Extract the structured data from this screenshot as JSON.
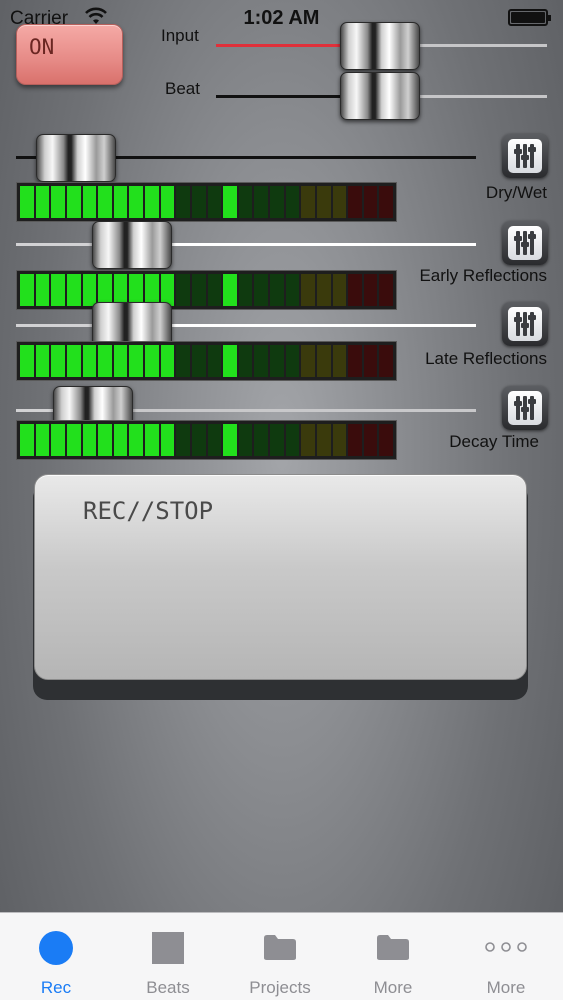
{
  "status_bar": {
    "carrier": "Carrier",
    "time": "1:02 AM"
  },
  "power_button": {
    "label": "ON"
  },
  "mixer": {
    "input": {
      "label": "Input",
      "level": 0.6
    },
    "beat": {
      "label": "Beat",
      "level": 0.6
    }
  },
  "effects": [
    {
      "label": "Dry/Wet",
      "level": 0.0
    },
    {
      "label": "Early Reflections",
      "level": 0.21
    },
    {
      "label": "Late Reflections",
      "level": 0.21
    },
    {
      "label": "Decay Time",
      "level": 0.08
    }
  ],
  "record_button": {
    "label": "REC//STOP"
  },
  "tabs": [
    {
      "label": "Rec",
      "icon": "record-icon",
      "active": true
    },
    {
      "label": "Beats",
      "icon": "square-icon",
      "active": false
    },
    {
      "label": "Projects",
      "icon": "folder-icon",
      "active": false
    },
    {
      "label": "More",
      "icon": "folder-icon",
      "active": false
    },
    {
      "label": "More",
      "icon": "ellipsis-icon",
      "active": false
    }
  ],
  "colors": {
    "accent": "#1a7cf5",
    "inactive_tab": "#8e8e93",
    "input_track": "#e0303a",
    "on_button": "#e68a86"
  }
}
